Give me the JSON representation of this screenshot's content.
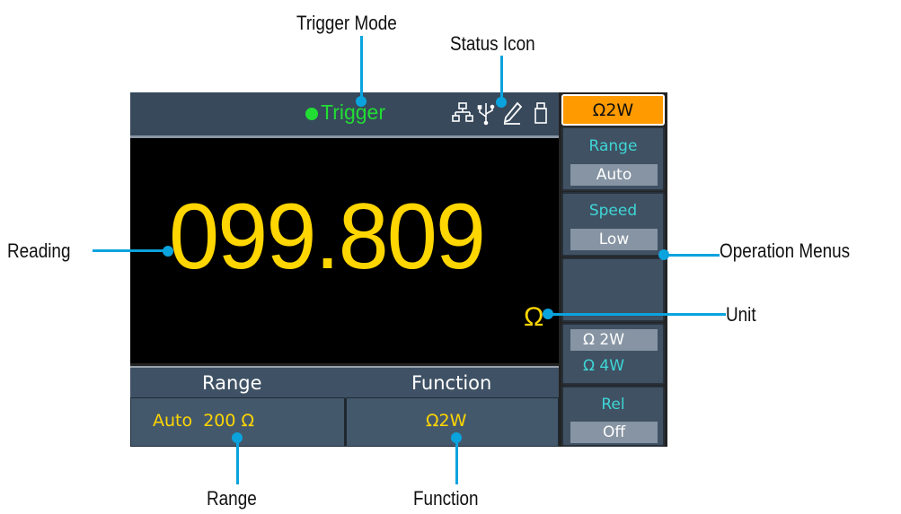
{
  "annotations": {
    "trigger_mode": "Trigger Mode",
    "status_icon": "Status Icon",
    "reading": "Reading",
    "operation_menus": "Operation Menus",
    "unit": "Unit",
    "range": "Range",
    "function": "Function"
  },
  "status_bar": {
    "trigger_text": "Trigger",
    "trigger_color": "#22dd33",
    "icons": [
      "network-icon",
      "usb-icon",
      "pen-icon",
      "usb-drive-icon"
    ]
  },
  "display": {
    "reading": "099.809",
    "unit": "Ω",
    "reading_color": "#ffd600"
  },
  "bottom": {
    "range_header": "Range",
    "function_header": "Function",
    "range_value": "Auto  200 Ω",
    "function_value": "Ω2W"
  },
  "menu": {
    "title": "Ω2W",
    "title_bg": "#ff9a00",
    "range_label": "Range",
    "range_value": "Auto",
    "speed_label": "Speed",
    "speed_value": "Low",
    "mode_selected": "Ω 2W",
    "mode_other": "Ω 4W",
    "rel_label": "Rel",
    "rel_value": "Off"
  }
}
